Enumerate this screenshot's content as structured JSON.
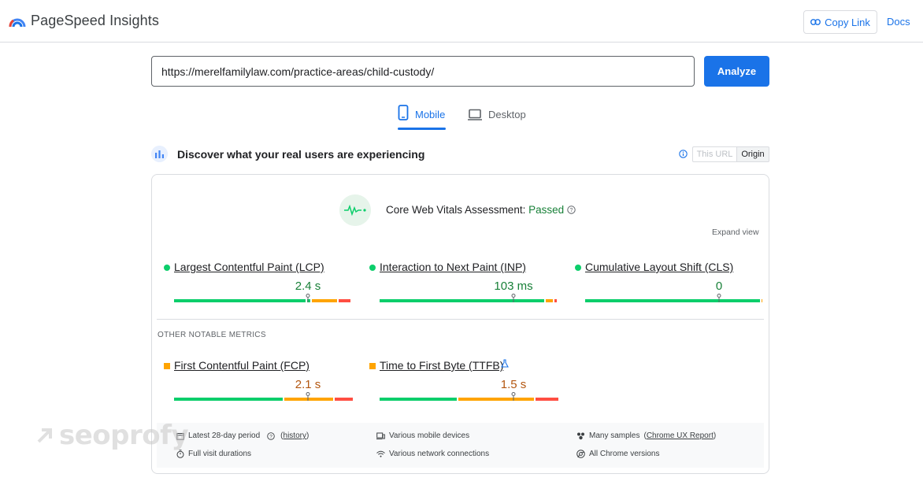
{
  "header": {
    "app_title": "PageSpeed Insights",
    "copy_link_label": "Copy Link",
    "docs_label": "Docs"
  },
  "search": {
    "url_value": "https://merelfamilylaw.com/practice-areas/child-custody/",
    "analyze_label": "Analyze"
  },
  "tabs": [
    {
      "label": "Mobile",
      "selected": true
    },
    {
      "label": "Desktop",
      "selected": false
    }
  ],
  "field_data": {
    "title": "Discover what your real users are experiencing",
    "scope_options": [
      "This URL",
      "Origin"
    ],
    "scope_selected": "Origin",
    "cwv_label": "Core Web Vitals Assessment:",
    "cwv_status": "Passed",
    "expand_label": "Expand view",
    "core_metrics": [
      {
        "name": "Largest Contentful Paint (LCP)",
        "value": "2.4 s",
        "rating": "good",
        "distribution": [
          0.75,
          0.15,
          0.07
        ],
        "marker": 0.75
      },
      {
        "name": "Interaction to Next Paint (INP)",
        "value": "103 ms",
        "rating": "good",
        "distribution": [
          0.93,
          0.04,
          0.01
        ],
        "marker": 0.75
      },
      {
        "name": "Cumulative Layout Shift (CLS)",
        "value": "0",
        "rating": "good",
        "distribution": [
          0.99,
          0.005,
          0.005
        ],
        "marker": 0.75
      }
    ],
    "other_title": "OTHER NOTABLE METRICS",
    "other_metrics": [
      {
        "name": "First Contentful Paint (FCP)",
        "value": "2.1 s",
        "rating": "avg",
        "distribution": [
          0.62,
          0.27,
          0.11
        ],
        "marker": 0.75
      },
      {
        "name": "Time to First Byte (TTFB)",
        "value": "1.5 s",
        "rating": "avg",
        "distribution": [
          0.44,
          0.43,
          0.13
        ],
        "marker": 0.75
      }
    ],
    "footer": {
      "period": "Latest 28-day period",
      "history_link": "history",
      "durations": "Full visit durations",
      "devices": "Various mobile devices",
      "connections": "Various network connections",
      "samples": "Many samples",
      "report_link": "Chrome UX Report",
      "versions": "All Chrome versions"
    }
  },
  "watermark": "seoprofy",
  "colors": {
    "accent": "#1a73e8",
    "good": "#0cce6b",
    "average": "#ffa400",
    "poor": "#ff4e42",
    "passed_text": "#188038"
  }
}
